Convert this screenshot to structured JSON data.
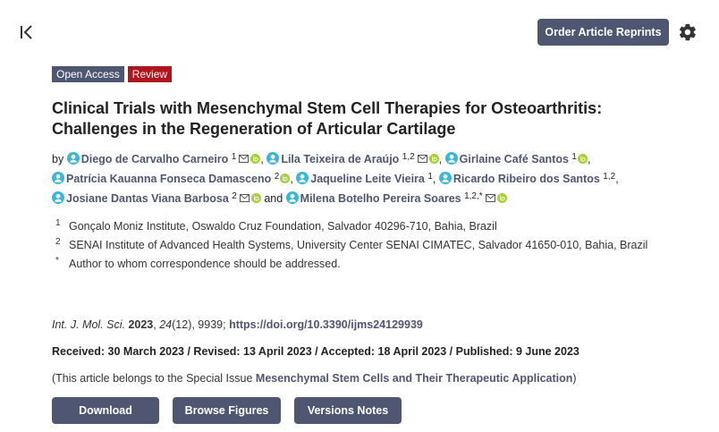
{
  "toolbar": {
    "collapse_icon": "collapse-left-icon",
    "reprint_label": "Order Article Reprints",
    "settings_icon": "gear-icon"
  },
  "badges": {
    "open_access": "Open Access",
    "review": "Review"
  },
  "title": "Clinical Trials with Mesenchymal Stem Cell Therapies for Osteoarthritis: Challenges in the Regeneration of Articular Cartilage",
  "authors": {
    "by": "by",
    "and": "and",
    "list": [
      {
        "name": "Diego de Carvalho Carneiro",
        "sup": "1"
      },
      {
        "name": "Lila Teixeira de Araújo",
        "sup": "1,2"
      },
      {
        "name": "Girlaine Café Santos",
        "sup": "1"
      },
      {
        "name": "Patrícia Kauanna Fonseca Damasceno",
        "sup": "2"
      },
      {
        "name": "Jaqueline Leite Vieira",
        "sup": "1"
      },
      {
        "name": "Ricardo Ribeiro dos Santos",
        "sup": "1,2"
      },
      {
        "name": "Josiane Dantas Viana Barbosa",
        "sup": "2"
      },
      {
        "name": "Milena Botelho Pereira Soares",
        "sup": "1,2,*"
      }
    ]
  },
  "affiliations": [
    {
      "num": "1",
      "text": "Gonçalo Moniz Institute, Oswaldo Cruz Foundation, Salvador 40296-710, Bahia, Brazil"
    },
    {
      "num": "2",
      "text": "SENAI Institute of Advanced Health Systems, University Center SENAI CIMATEC, Salvador 41650-010, Bahia, Brazil"
    },
    {
      "num": "*",
      "text": "Author to whom correspondence should be addressed."
    }
  ],
  "citation": {
    "journal": "Int. J. Mol. Sci.",
    "year": "2023",
    "volume": "24",
    "rest": "(12), 9939;",
    "doi": "https://doi.org/10.3390/ijms24129939"
  },
  "dates": "Received: 30 March 2023 / Revised: 13 April 2023 / Accepted: 18 April 2023 / Published: 9 June 2023",
  "special_issue": {
    "prefix": "(This article belongs to the Special Issue ",
    "link": "Mesenchymal Stem Cells and Their Therapeutic Application",
    "suffix": ")"
  },
  "actions": {
    "download": "Download",
    "figures": "Browse Figures",
    "versions": "Versions Notes"
  },
  "colors": {
    "accent": "#4f5671",
    "review": "#b0151d",
    "orcid": "#a6ce39",
    "author_icon": "#3ab7d6"
  }
}
